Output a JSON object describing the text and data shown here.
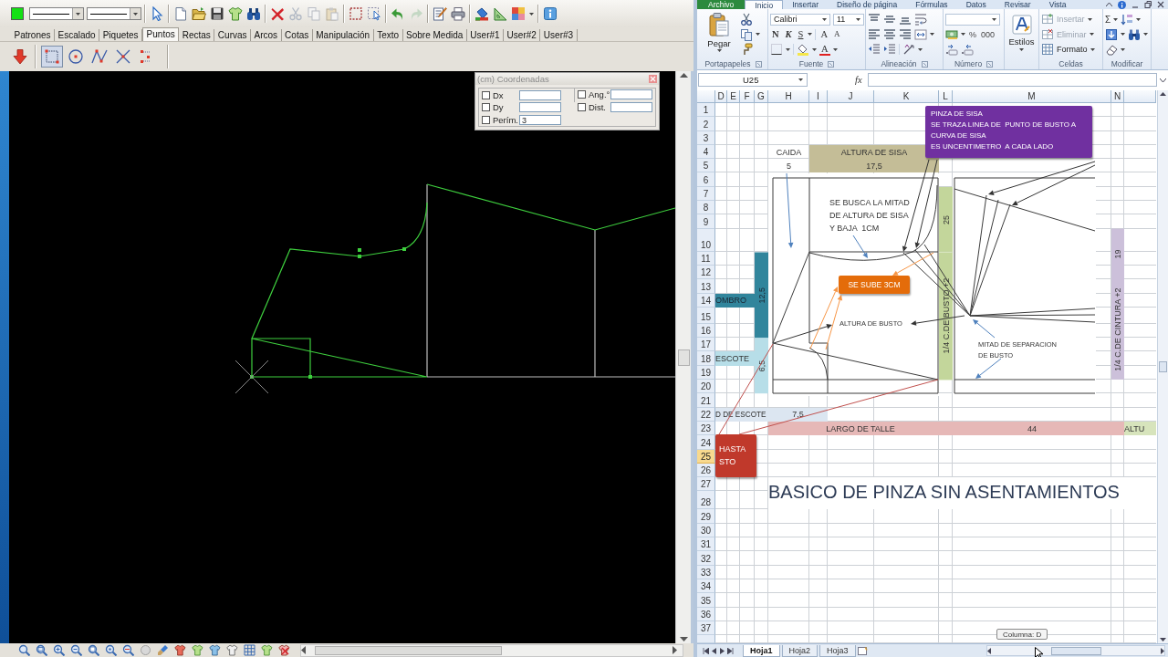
{
  "cad": {
    "tabs": [
      {
        "label": "Patrones",
        "selected": false
      },
      {
        "label": "Escalado",
        "selected": false
      },
      {
        "label": "Piquetes",
        "selected": false
      },
      {
        "label": "Puntos",
        "selected": true
      },
      {
        "label": "Rectas",
        "selected": false
      },
      {
        "label": "Curvas",
        "selected": false
      },
      {
        "label": "Arcos",
        "selected": false
      },
      {
        "label": "Cotas",
        "selected": false
      },
      {
        "label": "Manipulación",
        "selected": false
      },
      {
        "label": "Texto",
        "selected": false
      },
      {
        "label": "Sobre Medida",
        "selected": false
      },
      {
        "label": "User#1",
        "selected": false
      },
      {
        "label": "User#2",
        "selected": false
      },
      {
        "label": "User#3",
        "selected": false
      }
    ],
    "tools": [
      {
        "selected": true
      },
      {
        "selected": false
      },
      {
        "selected": false
      },
      {
        "selected": false
      },
      {
        "selected": false
      }
    ],
    "coordinates": {
      "title": "(cm) Coordenadas",
      "fields": [
        {
          "label": "Dx",
          "checked": false
        },
        {
          "label": "Dy",
          "checked": false
        },
        {
          "label": "Perím.",
          "checked": false,
          "value": "3"
        },
        {
          "label": "Ang.°",
          "checked": false
        },
        {
          "label": "Dist.",
          "checked": false
        }
      ]
    }
  },
  "excel": {
    "ribbon_tabs": [
      {
        "label": "Archivo",
        "kind": "file",
        "selected": false
      },
      {
        "label": "Inicio",
        "kind": "tab",
        "selected": true
      },
      {
        "label": "Insertar",
        "kind": "tab",
        "selected": false
      },
      {
        "label": "Diseño de página",
        "kind": "tab",
        "selected": false
      },
      {
        "label": "Fórmulas",
        "kind": "tab",
        "selected": false
      },
      {
        "label": "Datos",
        "kind": "tab",
        "selected": false
      },
      {
        "label": "Revisar",
        "kind": "tab",
        "selected": false
      },
      {
        "label": "Vista",
        "kind": "tab",
        "selected": false
      }
    ],
    "clipboard": {
      "paste": "Pegar",
      "group_label": "Portapapeles"
    },
    "font": {
      "name": "Calibri",
      "size": "11",
      "style_buttons": [
        "N",
        "K",
        "S"
      ],
      "grow": "A",
      "shrink": "A",
      "color_button": "A",
      "group_label": "Fuente"
    },
    "alignment": {
      "group_label": "Alineación"
    },
    "number": {
      "percent": "%",
      "thousands": "000",
      "group_label": "Número"
    },
    "styles": {
      "label": "Estilos"
    },
    "cells_group": {
      "buttons": [
        {
          "label": "Insertar",
          "disabled": true
        },
        {
          "label": "Eliminar",
          "disabled": true
        },
        {
          "label": "Formato",
          "disabled": false
        }
      ],
      "group_label": "Celdas"
    },
    "editing": {
      "sum": "Σ",
      "group_label": "Modificar"
    },
    "formula_bar": {
      "name_box": "U25",
      "function_label": "fx"
    },
    "column_headers": [
      "D",
      "E",
      "F",
      "G",
      "H",
      "I",
      "J",
      "K",
      "L",
      "M",
      "N"
    ],
    "rows": [
      {
        "label": "1",
        "selected": false
      },
      {
        "label": "2",
        "selected": false
      },
      {
        "label": "3",
        "selected": false
      },
      {
        "label": "4",
        "selected": false
      },
      {
        "label": "5",
        "selected": false
      },
      {
        "label": "6",
        "selected": false
      },
      {
        "label": "7",
        "selected": false
      },
      {
        "label": "8",
        "selected": false
      },
      {
        "label": "9",
        "selected": false
      },
      {
        "label": "10",
        "selected": false
      },
      {
        "label": "11",
        "selected": false
      },
      {
        "label": "12",
        "selected": false
      },
      {
        "label": "13",
        "selected": false
      },
      {
        "label": "14",
        "selected": false
      },
      {
        "label": "15",
        "selected": false
      },
      {
        "label": "16",
        "selected": false
      },
      {
        "label": "17",
        "selected": false
      },
      {
        "label": "18",
        "selected": false
      },
      {
        "label": "19",
        "selected": false
      },
      {
        "label": "20",
        "selected": false
      },
      {
        "label": "21",
        "selected": false
      },
      {
        "label": "22",
        "selected": false
      },
      {
        "label": "23",
        "selected": false
      },
      {
        "label": "24",
        "selected": false
      },
      {
        "label": "25",
        "selected": true
      },
      {
        "label": "26",
        "selected": false
      },
      {
        "label": "27",
        "selected": false
      },
      {
        "label": "28",
        "selected": false
      },
      {
        "label": "29",
        "selected": false
      },
      {
        "label": "30",
        "selected": false
      },
      {
        "label": "31",
        "selected": false
      },
      {
        "label": "32",
        "selected": false
      },
      {
        "label": "33",
        "selected": false
      },
      {
        "label": "34",
        "selected": false
      },
      {
        "label": "35",
        "selected": false
      },
      {
        "label": "36",
        "selected": false
      },
      {
        "label": "37",
        "selected": false
      }
    ],
    "cells": [
      {
        "kind": "plain",
        "text": "CAIDA"
      },
      {
        "kind": "plain",
        "text": "ALTURA DE SISA",
        "color": "#c4bd97"
      },
      {
        "kind": "plain",
        "text": "5"
      },
      {
        "kind": "plain",
        "text": "17,5",
        "color": "#c4bd97"
      },
      {
        "kind": "vertical",
        "text": "25",
        "color": "#c3d69b"
      },
      {
        "kind": "vertical",
        "text": "19",
        "color": "#ccc0da"
      },
      {
        "kind": "vertical",
        "text": "12,5",
        "color": "#31859c"
      },
      {
        "kind": "vertical",
        "text": "1/4 C.DE BUSTO +2",
        "color": "#c3d69b"
      },
      {
        "kind": "plain",
        "text": "OMBRO",
        "color": "#31859c"
      },
      {
        "kind": "vertical",
        "text": "1/4 C.DE CINTURA +2",
        "color": "#ccc0da"
      },
      {
        "kind": "vertical",
        "text": "6,5",
        "color": "#b7dee8"
      },
      {
        "kind": "plain",
        "text": "ESCOTE",
        "color": "#b7dee8"
      },
      {
        "kind": "plain",
        "text": "D DE ESCOTE",
        "color": "#dce6f1"
      },
      {
        "kind": "plain",
        "text": "7,5",
        "color": "#dce6f1"
      },
      {
        "kind": "plain",
        "text": "LARGO DE TALLE",
        "color": "#e6b8b7"
      },
      {
        "kind": "plain",
        "text": "44",
        "color": "#e6b8b7"
      },
      {
        "kind": "plain",
        "text": "ALTU",
        "color": "#d7e4bc"
      },
      {
        "kind": "title",
        "text": "BASICO DE PINZA SIN ASENTAMIENTOS"
      }
    ],
    "callouts": [
      {
        "text": "PINZA DE SISA\nSE TRAZA LINEA DE  PUNTO DE BUSTO A\nCURVA DE SISA\nES UNCENTIMETRO  A CADA LADO",
        "color": "#7030a0"
      },
      {
        "text": "SE SUBE 3CM",
        "color": "#e46c0a"
      },
      {
        "text": "HASTA\nSTO",
        "color": "#c0392b"
      }
    ],
    "notes": [
      "SE BUSCA LA MITAD\nDE ALTURA DE SISA\nY BAJA  1CM",
      "ALTURA DE BUSTO",
      "MITAD DE SEPARACION\nDE BUSTO"
    ],
    "sheet_tabs": [
      {
        "label": "Hoja1",
        "selected": true
      },
      {
        "label": "Hoja2",
        "selected": false
      },
      {
        "label": "Hoja3",
        "selected": false
      }
    ],
    "tooltip": "Columna: D"
  }
}
